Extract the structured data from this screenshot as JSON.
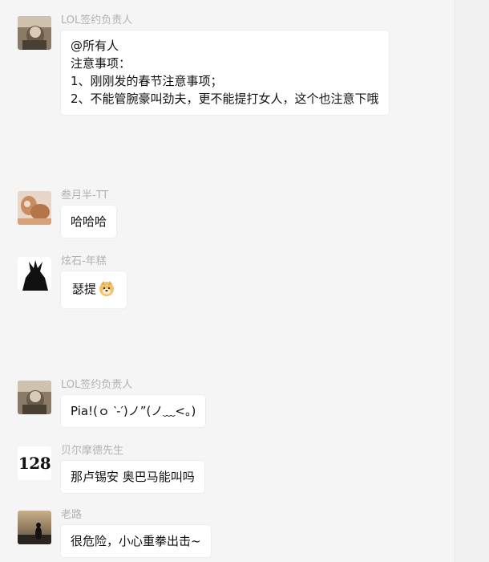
{
  "messages": [
    {
      "sender": "LOL签约负责人",
      "avatar": "cat-photo-avatar",
      "lines": [
        "@所有人",
        "注意事项：",
        "1、刚刚发的春节注意事项；",
        "2、不能管腕豪叫劲夫，更不能提打女人，这个也注意下哦"
      ]
    },
    {
      "sender": "叁月半-TT",
      "avatar": "girl-with-dog-avatar",
      "lines": [
        "哈哈哈"
      ]
    },
    {
      "sender": "炫石-年糕",
      "avatar": "dark-silhouette-avatar",
      "lines": [
        "瑟提"
      ],
      "emoji": "doge-emoji"
    },
    {
      "sender": "LOL签约负责人",
      "avatar": "cat-photo-avatar",
      "lines": [
        "Pia!(ｏ ‵-′)ノ”(ノ﹏<。)"
      ]
    },
    {
      "sender": "贝尔摩德先生",
      "avatar": "128",
      "lines": [
        "那卢锡安 奥巴马能叫吗"
      ]
    },
    {
      "sender": "老路",
      "avatar": "sunset-silhouette-avatar",
      "lines": [
        "很危险，小心重拳出击~"
      ]
    }
  ]
}
